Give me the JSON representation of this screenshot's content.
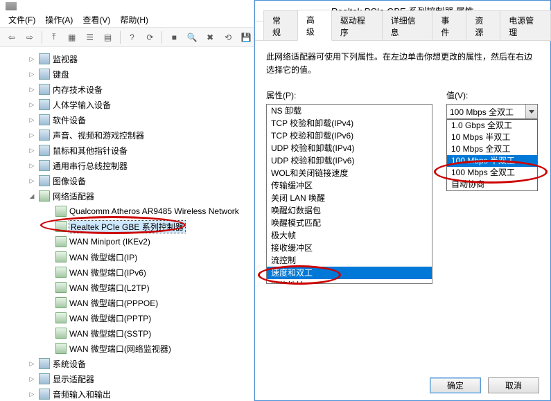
{
  "menubar": {
    "file": "文件(F)",
    "action": "操作(A)",
    "view": "查看(V)",
    "help": "帮助(H)"
  },
  "toolbar_icons": [
    "back",
    "forward",
    "up",
    "show-grid",
    "detail-1",
    "detail-2",
    "help",
    "refresh",
    "stop",
    "scan",
    "remove",
    "update",
    "disk"
  ],
  "tree": [
    {
      "indent": 1,
      "expander": "▷",
      "icon": "dev",
      "label": "监视器"
    },
    {
      "indent": 1,
      "expander": "▷",
      "icon": "dev",
      "label": "键盘"
    },
    {
      "indent": 1,
      "expander": "▷",
      "icon": "dev",
      "label": "内存技术设备"
    },
    {
      "indent": 1,
      "expander": "▷",
      "icon": "dev",
      "label": "人体学输入设备"
    },
    {
      "indent": 1,
      "expander": "▷",
      "icon": "dev",
      "label": "软件设备"
    },
    {
      "indent": 1,
      "expander": "▷",
      "icon": "dev",
      "label": "声音、视频和游戏控制器"
    },
    {
      "indent": 1,
      "expander": "▷",
      "icon": "dev",
      "label": "鼠标和其他指针设备"
    },
    {
      "indent": 1,
      "expander": "▷",
      "icon": "dev",
      "label": "通用串行总线控制器"
    },
    {
      "indent": 1,
      "expander": "▷",
      "icon": "dev",
      "label": "图像设备"
    },
    {
      "indent": 1,
      "expander": "◢",
      "icon": "net",
      "label": "网络适配器"
    },
    {
      "indent": 2,
      "expander": "",
      "icon": "net",
      "label": "Qualcomm Atheros AR9485 Wireless Network"
    },
    {
      "indent": 2,
      "expander": "",
      "icon": "net",
      "label": "Realtek PCIe GBE 系列控制器",
      "selected": true,
      "annot": "ellipse-1"
    },
    {
      "indent": 2,
      "expander": "",
      "icon": "net",
      "label": "WAN Miniport (IKEv2)"
    },
    {
      "indent": 2,
      "expander": "",
      "icon": "net",
      "label": "WAN 微型端口(IP)"
    },
    {
      "indent": 2,
      "expander": "",
      "icon": "net",
      "label": "WAN 微型端口(IPv6)"
    },
    {
      "indent": 2,
      "expander": "",
      "icon": "net",
      "label": "WAN 微型端口(L2TP)"
    },
    {
      "indent": 2,
      "expander": "",
      "icon": "net",
      "label": "WAN 微型端口(PPPOE)"
    },
    {
      "indent": 2,
      "expander": "",
      "icon": "net",
      "label": "WAN 微型端口(PPTP)"
    },
    {
      "indent": 2,
      "expander": "",
      "icon": "net",
      "label": "WAN 微型端口(SSTP)"
    },
    {
      "indent": 2,
      "expander": "",
      "icon": "net",
      "label": "WAN 微型端口(网络监视器)"
    },
    {
      "indent": 1,
      "expander": "▷",
      "icon": "dev",
      "label": "系统设备"
    },
    {
      "indent": 1,
      "expander": "▷",
      "icon": "dev",
      "label": "显示适配器"
    },
    {
      "indent": 1,
      "expander": "▷",
      "icon": "dev",
      "label": "音频输入和输出"
    }
  ],
  "dialog": {
    "title": "Realtek PCIe GBE 系列控制器 属性",
    "tabs": [
      "常规",
      "高级",
      "驱动程序",
      "详细信息",
      "事件",
      "资源",
      "电源管理"
    ],
    "active_tab": 1,
    "description": "此网络适配器可使用下列属性。在左边单击你想更改的属性，然后在右边选择它的值。",
    "prop_label": "属性(P):",
    "value_label": "值(V):",
    "properties": [
      "NS 卸载",
      "TCP 校验和卸载(IPv4)",
      "TCP 校验和卸载(IPv6)",
      "UDP 校验和卸载(IPv4)",
      "UDP 校验和卸载(IPv6)",
      "WOL和关闭链接速度",
      "传输缓冲区",
      "关闭 LAN 唤醒",
      "唤醒幻数据包",
      "唤醒模式匹配",
      "极大帧",
      "接收缓冲区",
      "流控制",
      "速度和双工",
      "网络地址"
    ],
    "selected_property_index": 13,
    "combo_value": "100 Mbps 全双工",
    "dropdown_options": [
      "1.0 Gbps 全双工",
      "10 Mbps 半双工",
      "10 Mbps 全双工",
      "100 Mbps 半双工",
      "100 Mbps 全双工",
      "自动协商"
    ],
    "dropdown_selected_index": 3,
    "buttons": {
      "ok": "确定",
      "cancel": "取消"
    }
  }
}
